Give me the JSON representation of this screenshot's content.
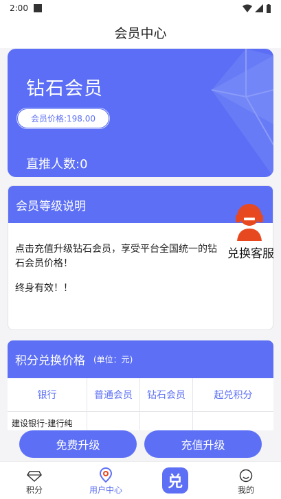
{
  "status_bar": {
    "time": "2:00"
  },
  "header": {
    "title": "会员中心"
  },
  "vip_card": {
    "level_name": "钻石会员",
    "price_label": "会员价格:198.00",
    "direct_referrals": "直推人数:0"
  },
  "level_section": {
    "title": "会员等级说明",
    "description": "点击充值升级钻石会员，享受平台全国统一的钻石会员价格！",
    "note": "终身有效！！"
  },
  "customer_service": {
    "label": "兑换客服"
  },
  "exchange_section": {
    "title": "积分兑换价格",
    "unit": "(单位：元)",
    "columns": [
      "银行",
      "普通会员",
      "钻石会员",
      "起兑积分"
    ],
    "rows": [
      [
        "建设银行-建行纯",
        "",
        "",
        ""
      ]
    ]
  },
  "actions": {
    "free_upgrade": "免费升级",
    "recharge_upgrade": "充值升级"
  },
  "bottom_nav": {
    "points": "积分",
    "user_center": "用户中心",
    "exchange_glyph": "兑",
    "mine": "我的"
  },
  "colors": {
    "accent": "#5d70f5",
    "card_bg": "#5b6ef5"
  }
}
